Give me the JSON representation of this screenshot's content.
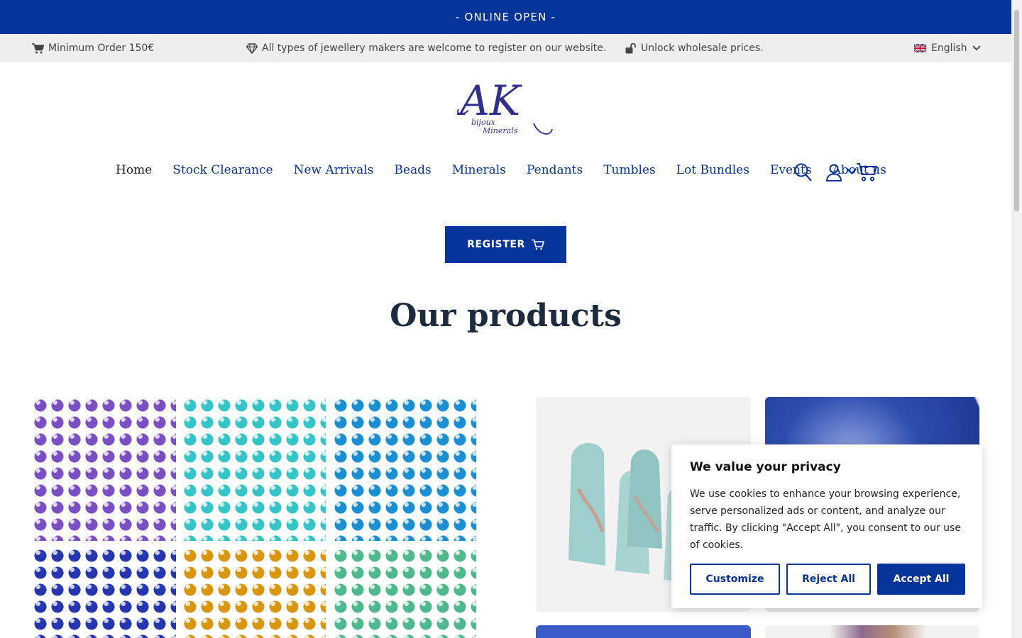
{
  "announcement": "- ONLINE OPEN -",
  "infobar": {
    "min_order": "Minimum Order 150€",
    "welcome": "All types of jewellery makers are welcome to register on our website.",
    "unlock": "Unlock wholesale prices.",
    "language": "English"
  },
  "logo": {
    "initials": "AK",
    "line1": "bijoux",
    "line2": "Minerals"
  },
  "nav": {
    "items": [
      "Home",
      "Stock Clearance",
      "New Arrivals",
      "Beads",
      "Minerals",
      "Pendants",
      "Tumbles",
      "Lot Bundles",
      "Events",
      "About us"
    ]
  },
  "register_label": "REGISTER",
  "heading": "Our products",
  "product_tiles": {
    "bead_colors": [
      "#7b4fc4",
      "#36c4c9",
      "#1a8fd1",
      "#2536b0",
      "#d9960f",
      "#4fb98e"
    ],
    "mineral_colors": [
      "#9fcfcc",
      "#2e4fb0",
      "#3a5cc8",
      "#8e6a8c"
    ]
  },
  "cookie": {
    "title": "We value your privacy",
    "text": "We use cookies to enhance your browsing experience, serve personalized ads or content, and analyze our traffic. By clicking \"Accept All\", you consent to our use of cookies.",
    "customize": "Customize",
    "reject": "Reject All",
    "accept": "Accept All"
  },
  "colors": {
    "brand": "#04339a",
    "infobar_bg": "#eeeeee"
  }
}
